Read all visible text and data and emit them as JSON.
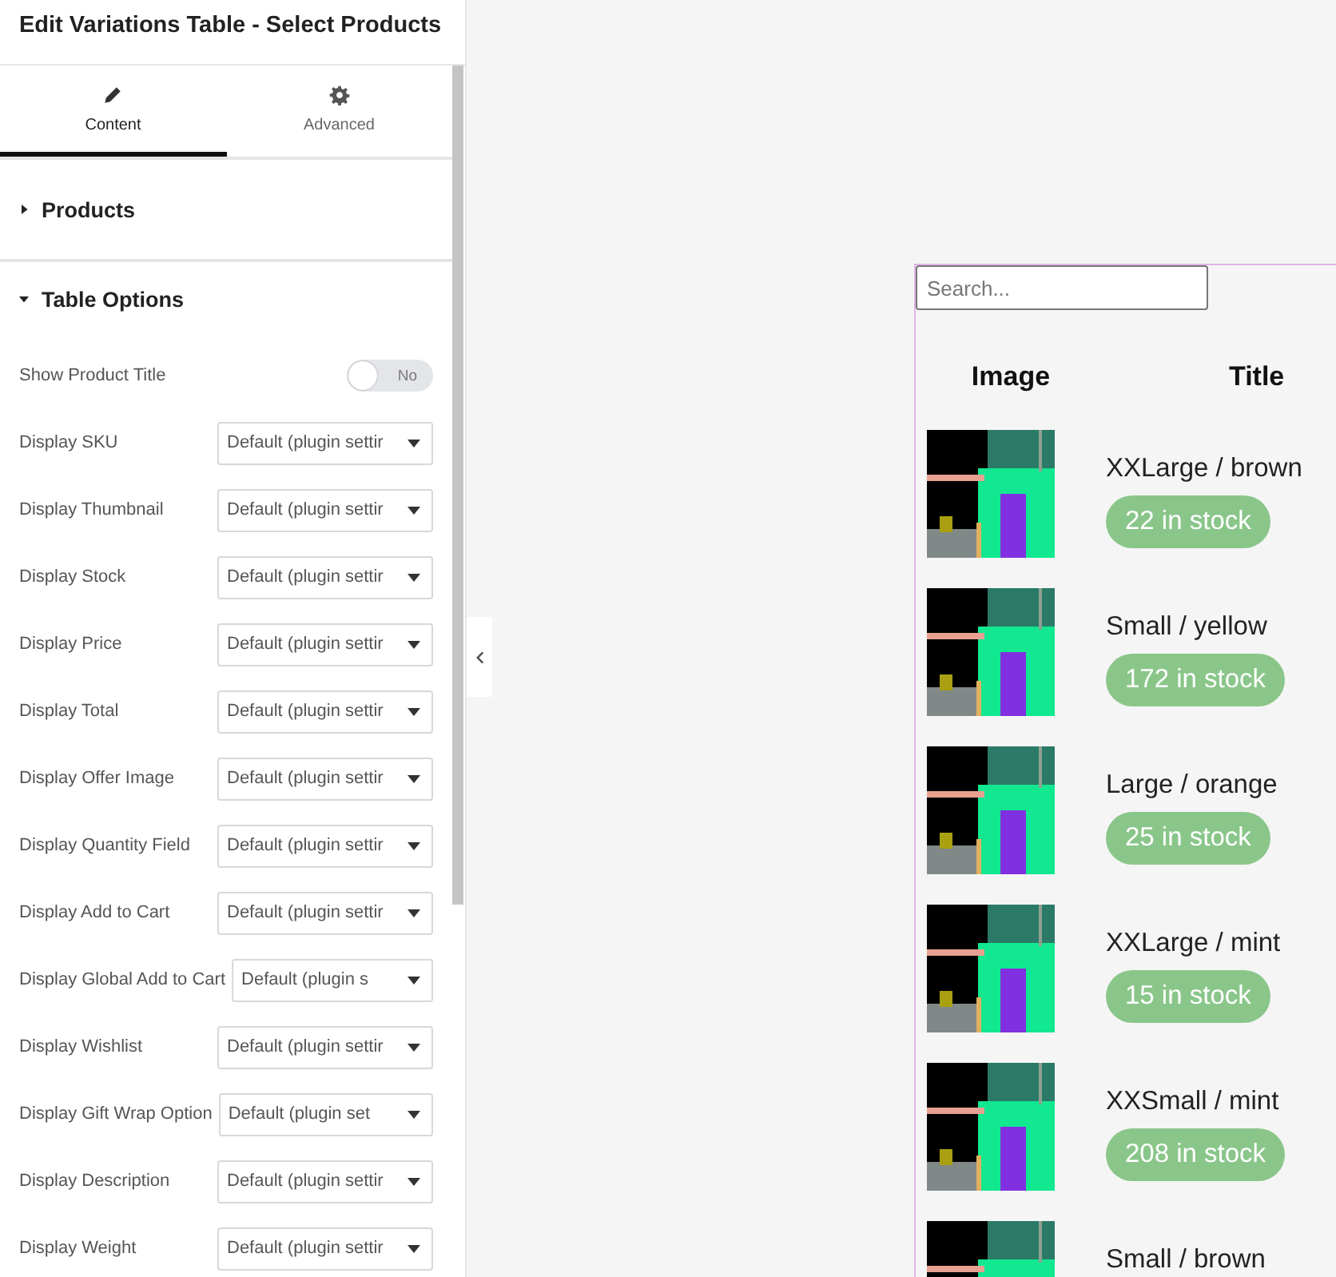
{
  "panel": {
    "title": "Edit Variations Table - Select Products",
    "tabs": [
      {
        "label": "Content",
        "selected": true
      },
      {
        "label": "Advanced",
        "selected": false
      }
    ],
    "sections": [
      {
        "title": "Products",
        "expanded": false
      },
      {
        "title": "Table Options",
        "expanded": true
      }
    ],
    "options": [
      {
        "kind": "toggle",
        "label": "Show Product Title",
        "on": false,
        "value": "No"
      },
      {
        "kind": "select",
        "label": "Display SKU",
        "value": "Default (plugin settir"
      },
      {
        "kind": "select",
        "label": "Display Thumbnail",
        "value": "Default (plugin settir"
      },
      {
        "kind": "select",
        "label": "Display Stock",
        "value": "Default (plugin settir"
      },
      {
        "kind": "select",
        "label": "Display Price",
        "value": "Default (plugin settir"
      },
      {
        "kind": "select",
        "label": "Display Total",
        "value": "Default (plugin settir"
      },
      {
        "kind": "select",
        "label": "Display Offer Image",
        "value": "Default (plugin settir"
      },
      {
        "kind": "select",
        "label": "Display Quantity Field",
        "value": "Default (plugin settir"
      },
      {
        "kind": "select",
        "label": "Display Add to Cart",
        "value": "Default (plugin settir"
      },
      {
        "kind": "select",
        "label": "Display Global Add to Cart",
        "value": "Default (plugin s"
      },
      {
        "kind": "select",
        "label": "Display Wishlist",
        "value": "Default (plugin settir"
      },
      {
        "kind": "select",
        "label": "Display Gift Wrap Option",
        "value": "Default (plugin set"
      },
      {
        "kind": "select",
        "label": "Display Description",
        "value": "Default (plugin settir"
      },
      {
        "kind": "select",
        "label": "Display Weight",
        "value": "Default (plugin settir"
      }
    ]
  },
  "preview": {
    "search": {
      "placeholder": "Search..."
    },
    "columns": [
      "Image",
      "Title"
    ],
    "rows": [
      {
        "title": "XXLarge / brown",
        "stock": "22 in stock"
      },
      {
        "title": "Small / yellow",
        "stock": "172 in stock"
      },
      {
        "title": "Large / orange",
        "stock": "25 in stock"
      },
      {
        "title": "XXLarge / mint",
        "stock": "15 in stock"
      },
      {
        "title": "XXSmall / mint",
        "stock": "208 in stock"
      },
      {
        "title": "Small / brown"
      }
    ]
  }
}
